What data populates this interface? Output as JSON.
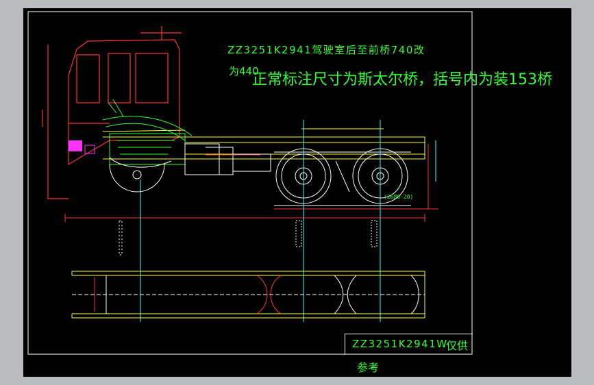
{
  "notes": {
    "line1": "ZZ3251K2941驾驶室后至前桥740改",
    "line2_prefix": "为440",
    "line2_main": "正常标注尺寸为斯太尔桥，括号内为装153桥"
  },
  "title_block": {
    "model": "ZZ3251K2941W",
    "only": "仅供",
    "reference": "参考"
  },
  "dimension_text": "(2680-20)",
  "colors": {
    "background": "#000000",
    "window": "#b9bcc0",
    "annotation_green": "#33ff33",
    "frame_white": "#ffffff",
    "line_yellow": "#ffff33",
    "line_red": "#ff3333",
    "line_cyan": "#33ffff",
    "line_magenta": "#ff33ff"
  }
}
